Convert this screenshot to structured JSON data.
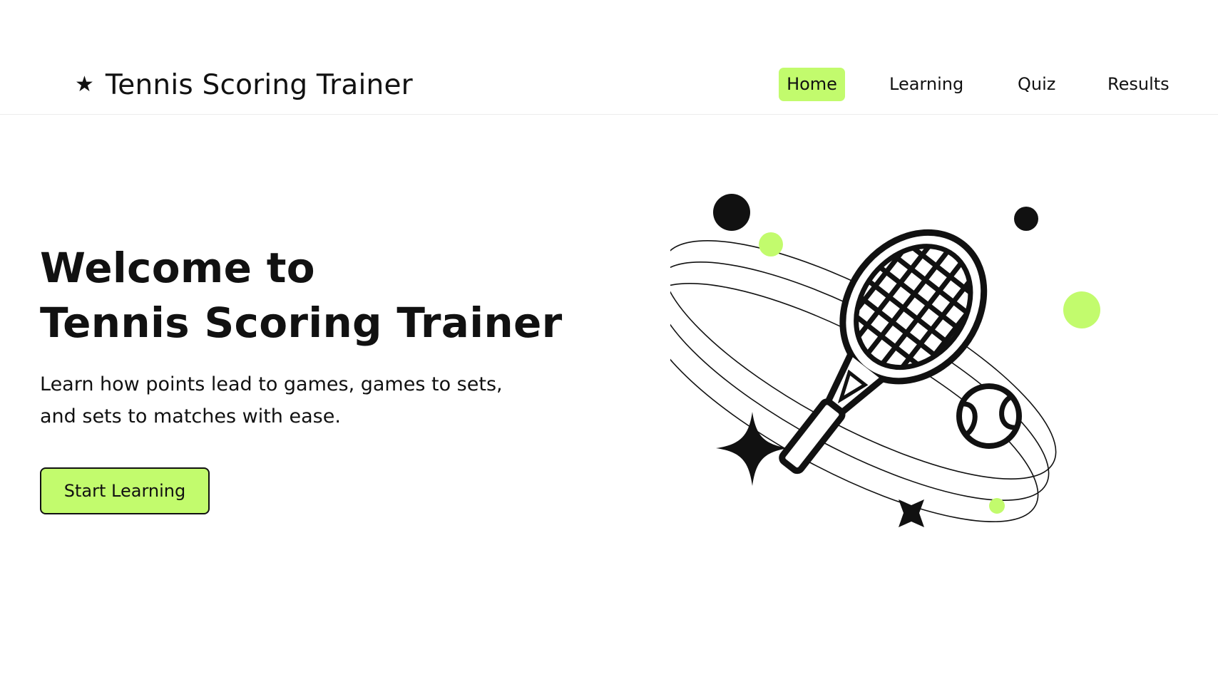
{
  "header": {
    "brand_icon": "★",
    "brand_title": "Tennis Scoring Trainer",
    "nav": [
      {
        "label": "Home",
        "active": true
      },
      {
        "label": "Learning",
        "active": false
      },
      {
        "label": "Quiz",
        "active": false
      },
      {
        "label": "Results",
        "active": false
      }
    ]
  },
  "hero": {
    "title_line1": "Welcome to",
    "title_line2": "Tennis Scoring Trainer",
    "subtitle_line1": "Learn how points lead to games, games to sets,",
    "subtitle_line2": "and sets to matches with ease.",
    "cta_label": "Start Learning"
  },
  "illustration": {
    "icons": [
      "tennis-racket-icon",
      "tennis-ball-icon",
      "sparkle-star-icon",
      "orbit-rings"
    ]
  },
  "colors": {
    "accent": "#c2fb6d",
    "text": "#111111",
    "background": "#ffffff",
    "divider": "#ececec"
  }
}
